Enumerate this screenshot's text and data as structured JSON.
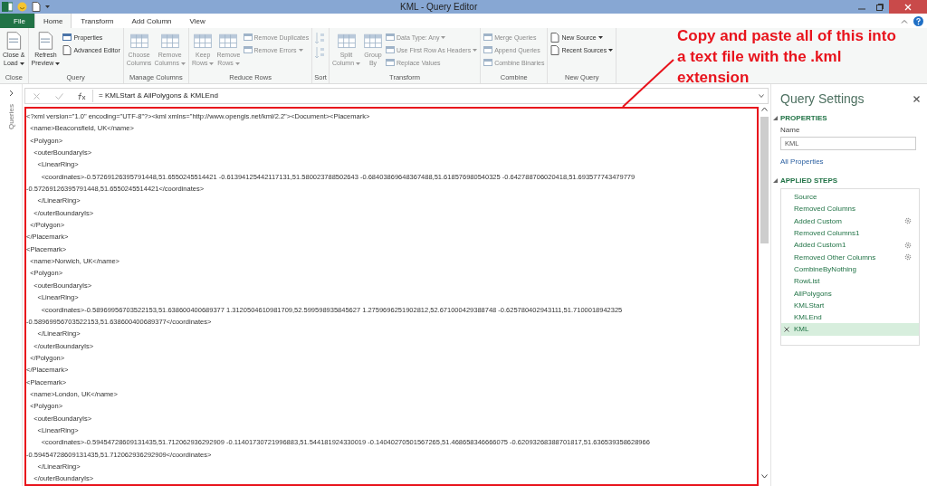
{
  "window": {
    "title": "KML - Query Editor"
  },
  "tabs": [
    {
      "label": "File",
      "kind": "file",
      "selected": false
    },
    {
      "label": "Home",
      "kind": "tab",
      "selected": true
    },
    {
      "label": "Transform",
      "kind": "tab",
      "selected": false
    },
    {
      "label": "Add Column",
      "kind": "tab",
      "selected": false
    },
    {
      "label": "View",
      "kind": "tab",
      "selected": false
    }
  ],
  "ribbon": {
    "groups": [
      {
        "label": "Close",
        "items": [
          {
            "kind": "large",
            "lines": [
              "Close &",
              "Load"
            ],
            "dropdown": true,
            "disabled": false
          }
        ]
      },
      {
        "label": "Query",
        "items": [
          {
            "kind": "large",
            "lines": [
              "Refresh",
              "Preview"
            ],
            "dropdown": true,
            "disabled": false
          },
          {
            "kind": "small",
            "label": "Properties",
            "dropdown": false,
            "disabled": false
          },
          {
            "kind": "small",
            "label": "Advanced Editor",
            "dropdown": false,
            "disabled": false
          }
        ]
      },
      {
        "label": "Manage Columns",
        "items": [
          {
            "kind": "large",
            "lines": [
              "Choose",
              "Columns"
            ],
            "dropdown": false,
            "disabled": true
          },
          {
            "kind": "large",
            "lines": [
              "Remove",
              "Columns"
            ],
            "dropdown": true,
            "disabled": true
          }
        ]
      },
      {
        "label": "Reduce Rows",
        "items": [
          {
            "kind": "large",
            "lines": [
              "Keep",
              "Rows"
            ],
            "dropdown": true,
            "disabled": true
          },
          {
            "kind": "large",
            "lines": [
              "Remove",
              "Rows"
            ],
            "dropdown": true,
            "disabled": true
          },
          {
            "kind": "small",
            "label": "Remove Duplicates",
            "dropdown": false,
            "disabled": true
          },
          {
            "kind": "small",
            "label": "Remove Errors",
            "dropdown": true,
            "disabled": true
          }
        ]
      },
      {
        "label": "Sort",
        "items": [
          {
            "kind": "sort",
            "disabled": true
          },
          {
            "kind": "sort",
            "disabled": true
          }
        ]
      },
      {
        "label": "Transform",
        "items": [
          {
            "kind": "large",
            "lines": [
              "Split",
              "Column"
            ],
            "dropdown": true,
            "disabled": true
          },
          {
            "kind": "large",
            "lines": [
              "Group",
              "By"
            ],
            "dropdown": false,
            "disabled": true
          },
          {
            "kind": "small",
            "label": "Data Type: Any",
            "dropdown": true,
            "disabled": true
          },
          {
            "kind": "small",
            "label": "Use First Row As Headers",
            "dropdown": true,
            "disabled": true
          },
          {
            "kind": "small",
            "label": "Replace Values",
            "dropdown": false,
            "disabled": true
          }
        ]
      },
      {
        "label": "Combine",
        "items": [
          {
            "kind": "small",
            "label": "Merge Queries",
            "dropdown": false,
            "disabled": true
          },
          {
            "kind": "small",
            "label": "Append Queries",
            "dropdown": false,
            "disabled": true
          },
          {
            "kind": "small",
            "label": "Combine Binaries",
            "dropdown": false,
            "disabled": true
          }
        ]
      },
      {
        "label": "New Query",
        "items": [
          {
            "kind": "small",
            "label": "New Source",
            "dropdown": true,
            "disabled": false
          },
          {
            "kind": "small",
            "label": "Recent Sources",
            "dropdown": true,
            "disabled": false
          }
        ]
      }
    ]
  },
  "annotation": {
    "lines": [
      "Copy and paste all of this into",
      "a text file with the .kml",
      "extension"
    ]
  },
  "queries_pane": {
    "label": "Queries"
  },
  "formula_bar": {
    "formula": "= KMLStart & AllPolygons & KMLEnd"
  },
  "document": {
    "lines": [
      "<?xml version=\"1.0\" encoding=\"UTF-8\"?><kml xmlns=\"http://www.opengis.net/kml/2.2\"><Document><Placemark>",
      "  <name>Beaconsfield, UK</name>",
      "  <Polygon>",
      "    <outerBoundaryIs>",
      "      <LinearRing>",
      "        <coordinates>-0.57269126395791448,51.6550245514421 -0.61394125442117131,51.580023788502643 -0.68403869648367488,51.618576980540325 -0.642788706020418,51.693577743479779",
      "-0.57269126395791448,51.6550245514421</coordinates>",
      "      </LinearRing>",
      "    </outerBoundaryIs>",
      "  </Polygon>",
      "</Placemark>",
      "<Placemark>",
      "  <name>Norwich, UK</name>",
      "  <Polygon>",
      "    <outerBoundaryIs>",
      "      <LinearRing>",
      "        <coordinates>-0.58969956703522153,51.638600400689377 1.3120504610981709,52.599598935845627 1.2759696251902812,52.671000429388748 -0.625780402943111,51.7100018942325",
      "-0.58969956703522153,51.638600400689377</coordinates>",
      "      </LinearRing>",
      "    </outerBoundaryIs>",
      "  </Polygon>",
      "</Placemark>",
      "<Placemark>",
      "  <name>London, UK</name>",
      "  <Polygon>",
      "    <outerBoundaryIs>",
      "      <LinearRing>",
      "        <coordinates>-0.59454728609131435,51.712062936292909 -0.11401730721996883,51.544181924330019 -0.14040270501567265,51.468658346666075 -0.62093268388701817,51.636539358628966",
      "-0.59454728609131435,51.712062936292909</coordinates>",
      "      </LinearRing>",
      "    </outerBoundaryIs>"
    ]
  },
  "settings": {
    "title": "Query Settings",
    "properties_heading": "PROPERTIES",
    "name_label": "Name",
    "name_value": "KML",
    "all_properties": "All Properties",
    "steps_heading": "APPLIED STEPS",
    "steps": [
      {
        "label": "Source",
        "settings": false,
        "selected": false
      },
      {
        "label": "Removed Columns",
        "settings": false,
        "selected": false
      },
      {
        "label": "Added Custom",
        "settings": true,
        "selected": false
      },
      {
        "label": "Removed Columns1",
        "settings": false,
        "selected": false
      },
      {
        "label": "Added Custom1",
        "settings": true,
        "selected": false
      },
      {
        "label": "Removed Other Columns",
        "settings": true,
        "selected": false
      },
      {
        "label": "CombineByNothing",
        "settings": false,
        "selected": false
      },
      {
        "label": "RowList",
        "settings": false,
        "selected": false
      },
      {
        "label": "AllPolygons",
        "settings": false,
        "selected": false
      },
      {
        "label": "KMLStart",
        "settings": false,
        "selected": false
      },
      {
        "label": "KMLEnd",
        "settings": false,
        "selected": false
      },
      {
        "label": "KML",
        "settings": false,
        "selected": true
      }
    ]
  }
}
